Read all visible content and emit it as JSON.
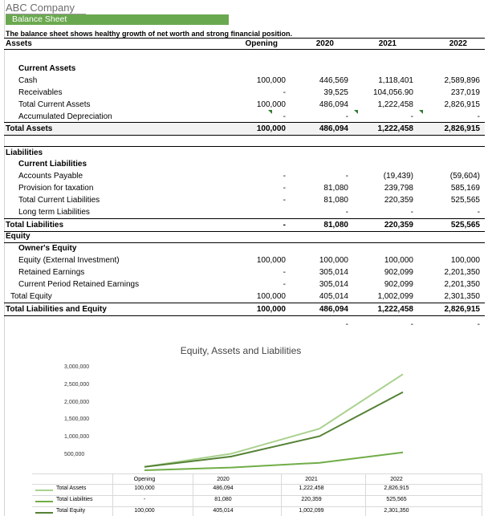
{
  "header": {
    "company": "ABC Company",
    "sheet_title": "Balance Sheet",
    "description": "The balance sheet shows healthy growth of net worth and strong financial position."
  },
  "columns": {
    "label": "Assets",
    "c0": "Opening",
    "c1": "2020",
    "c2": "2021",
    "c3": "2022"
  },
  "rows": [
    {
      "label": "Current Assets",
      "bold": true,
      "indent": 18,
      "values": [
        "",
        "",
        "",
        ""
      ]
    },
    {
      "label": "Cash",
      "indent": 18,
      "values": [
        "100,000",
        "446,569",
        "1,118,401",
        "2,589,896"
      ]
    },
    {
      "label": "Receivables",
      "indent": 18,
      "values": [
        "-",
        "39,525",
        "104,056.90",
        "237,019"
      ]
    },
    {
      "label": "Total Current Assets",
      "indent": 18,
      "values": [
        "100,000",
        "486,094",
        "1,222,458",
        "2,826,915"
      ]
    },
    {
      "label": "Accumulated Depreciation",
      "indent": 18,
      "values": [
        "-",
        "-",
        "-",
        "-"
      ]
    },
    {
      "label": "Total Assets",
      "bold": true,
      "indent": 2,
      "values": [
        "100,000",
        "486,094",
        "1,222,458",
        "2,826,915"
      ]
    },
    {
      "label": "Liabilities",
      "bold": true,
      "indent": 2,
      "values": [
        "",
        "",
        "",
        ""
      ]
    },
    {
      "label": "Current Liabilities",
      "bold": true,
      "indent": 18,
      "values": [
        "",
        "",
        "",
        ""
      ]
    },
    {
      "label": "Accounts Payable",
      "indent": 18,
      "values": [
        "-",
        "-",
        "(19,439)",
        "(59,604)"
      ]
    },
    {
      "label": "Provision for taxation",
      "indent": 18,
      "values": [
        "-",
        "81,080",
        "239,798",
        "585,169"
      ]
    },
    {
      "label": "Total Current Liabilities",
      "indent": 18,
      "values": [
        "-",
        "81,080",
        "220,359",
        "525,565"
      ]
    },
    {
      "label": "Long term Liabilities",
      "indent": 18,
      "values": [
        "",
        "-",
        "-",
        "-"
      ]
    },
    {
      "label": "Total Liabilities",
      "bold": true,
      "indent": 2,
      "values": [
        "-",
        "81,080",
        "220,359",
        "525,565"
      ]
    },
    {
      "label": "Equity",
      "bold": true,
      "indent": 2,
      "values": [
        "",
        "",
        "",
        ""
      ]
    },
    {
      "label": "Owner's Equity",
      "bold": true,
      "indent": 18,
      "values": [
        "",
        "",
        "",
        ""
      ]
    },
    {
      "label": "Equity  (External Investment)",
      "indent": 18,
      "values": [
        "100,000",
        "100,000",
        "100,000",
        "100,000"
      ]
    },
    {
      "label": "Retained Earnings",
      "indent": 18,
      "values": [
        "-",
        "305,014",
        "902,099",
        "2,201,350"
      ]
    },
    {
      "label": "Current Period Retained Earnings",
      "indent": 18,
      "values": [
        "-",
        "305,014",
        "902,099",
        "2,201,350"
      ]
    },
    {
      "label": "Total Equity",
      "indent": 8,
      "values": [
        "100,000",
        "405,014",
        "1,002,099",
        "2,301,350"
      ]
    },
    {
      "label": "Total Liabilities and Equity",
      "bold": true,
      "indent": 2,
      "values": [
        "100,000",
        "486,094",
        "1,222,458",
        "2,826,915"
      ]
    },
    {
      "label": "",
      "indent": 2,
      "values": [
        "",
        "-",
        "-",
        "-"
      ]
    }
  ],
  "chart_data": {
    "type": "line",
    "title": "Equity, Assets and Liabilities",
    "categories": [
      "Opening",
      "2020",
      "2021",
      "2022"
    ],
    "ylim": [
      0,
      3000000
    ],
    "yticks": [
      "3,000,000",
      "2,500,000",
      "2,000,000",
      "1,500,000",
      "1,000,000",
      "500,000"
    ],
    "series": [
      {
        "name": "Total Assets",
        "values": [
          100000,
          486094,
          1222458,
          2826915
        ],
        "labels": [
          "100,000",
          "486,094",
          "1,222,458",
          "2,826,915"
        ],
        "color": "#a9d18e"
      },
      {
        "name": "Total Liabilities",
        "values": [
          0,
          81080,
          220359,
          525565
        ],
        "labels": [
          "-",
          "81,080",
          "220,359",
          "525,565"
        ],
        "color": "#70ad47"
      },
      {
        "name": "Total Equity",
        "values": [
          100000,
          405014,
          1002099,
          2301350
        ],
        "labels": [
          "100,000",
          "405,014",
          "1,002,099",
          "2,301,350"
        ],
        "color": "#548235"
      }
    ]
  }
}
